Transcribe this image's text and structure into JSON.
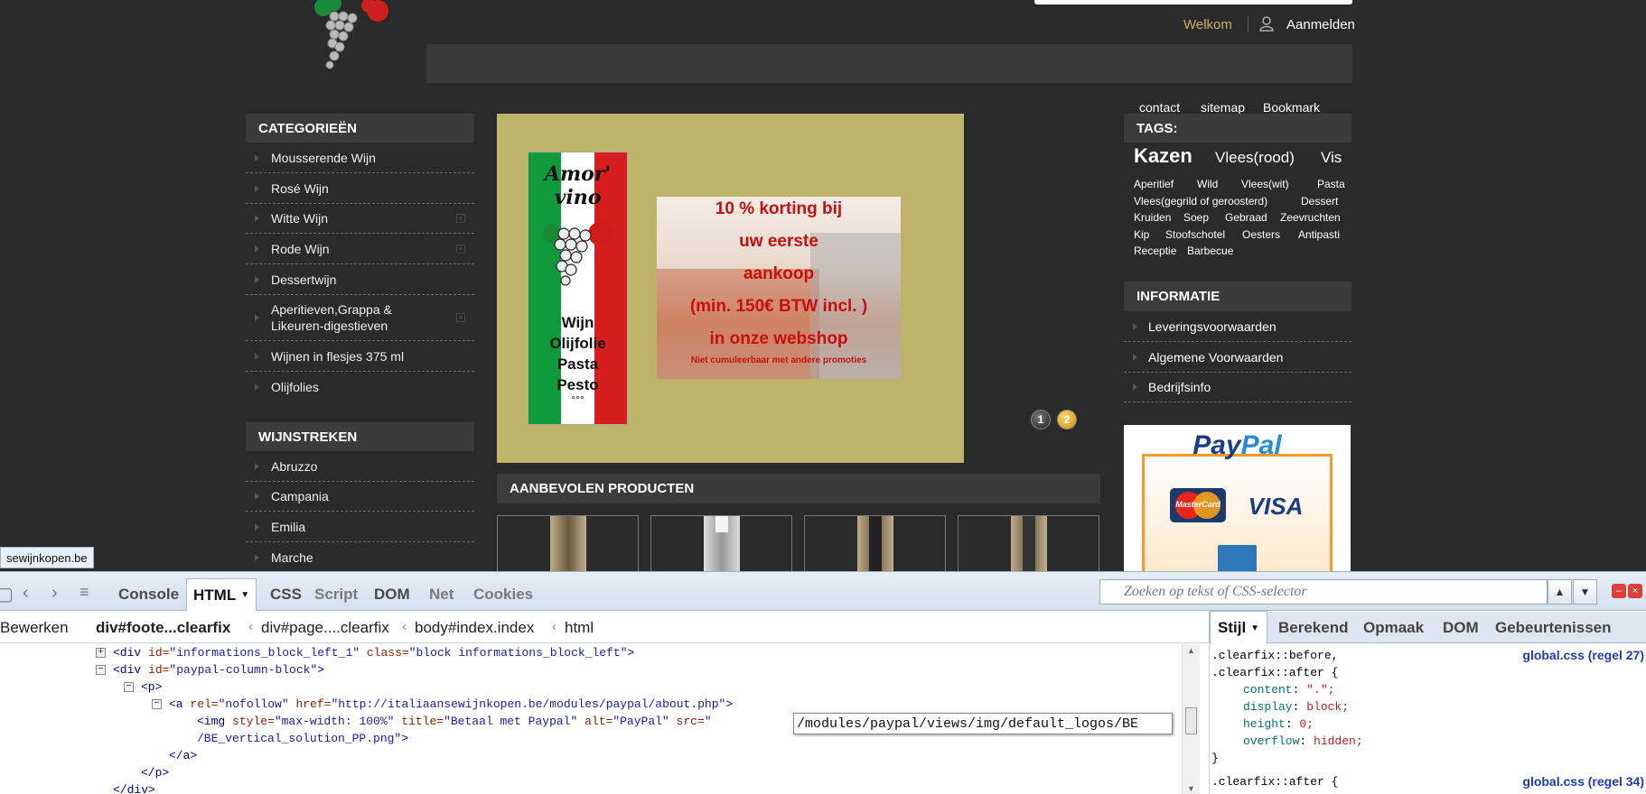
{
  "site": {
    "header": {
      "welcome": "Welkom",
      "login": "Aanmelden"
    },
    "categories": {
      "title": "CATEGORIEËN",
      "items": [
        {
          "label": "Mousserende Wijn",
          "expandable": false
        },
        {
          "label": "Rosé Wijn",
          "expandable": false
        },
        {
          "label": "Witte Wijn",
          "expandable": true
        },
        {
          "label": "Rode Wijn",
          "expandable": true
        },
        {
          "label": "Dessertwijn",
          "expandable": false
        },
        {
          "label": "Aperitieven,Grappa & Likeuren-digestieven",
          "expandable": true
        },
        {
          "label": "Wijnen in flesjes 375 ml",
          "expandable": false
        },
        {
          "label": "Olijfolies",
          "expandable": false
        }
      ]
    },
    "regions": {
      "title": "WIJNSTREKEN",
      "items": [
        "Abruzzo",
        "Campania",
        "Emilia",
        "Marche"
      ]
    },
    "banner": {
      "vertical_title": "Amor' vino",
      "vertical_words": [
        "Wijn",
        "Olijfolie",
        "Pasta",
        "Pesto"
      ],
      "vertical_dots": "°°°",
      "promo_lines": [
        "10 % korting bij",
        "uw eerste",
        "aankoop",
        "(min. 150€ BTW incl. )",
        "in onze webshop"
      ],
      "promo_small": "Niet cumuleerbaar met andere promoties",
      "pages": [
        "1",
        "2"
      ],
      "active_page": 2
    },
    "recommended": {
      "title": "AANBEVOLEN PRODUCTEN"
    },
    "footer_links": [
      "contact",
      "sitemap",
      "Bookmark"
    ],
    "tags": {
      "title": "TAGS:",
      "items": [
        "Kazen",
        "Vlees(rood)",
        "Vis",
        "Aperitief",
        "Wild",
        "Vlees(wit)",
        "Pasta",
        "Vlees(gegrild of geroosterd)",
        "Dessert",
        "Kruiden",
        "Soep",
        "Gebraad",
        "Zeevruchten",
        "Kip",
        "Stoofschotel",
        "Oesters",
        "Antipasti",
        "Receptie",
        "Barbecue"
      ]
    },
    "info": {
      "title": "INFORMATIE",
      "items": [
        "Leveringsvoorwaarden",
        "Algemene Voorwaarden",
        "Bedrijfsinfo"
      ]
    },
    "paypal": {
      "logo_a": "Pay",
      "logo_b": "Pal",
      "mastercard": "MasterCard",
      "visa": "VISA"
    },
    "status_tip": "sewijnkopen.be"
  },
  "firebug": {
    "tabs": [
      "Console",
      "HTML",
      "CSS",
      "Script",
      "DOM",
      "Net",
      "Cookies"
    ],
    "active_tab": "HTML",
    "search_placeholder": "Zoeken op tekst of CSS-selector",
    "edit_label": "Bewerken",
    "breadcrumbs": [
      "div#foote...clearfix",
      "div#page....clearfix",
      "body#index.index",
      "html"
    ],
    "side_tabs": [
      "Stijl",
      "Berekend",
      "Opmaak",
      "DOM",
      "Gebeurtenissen"
    ],
    "html_lines": [
      {
        "tag_open": "<div ",
        "a1": "id=",
        "v1": "\"informations_block_left_1\"",
        "a2": " class=",
        "v2": "\"block informations_block_left\"",
        "tag_close": ">"
      },
      {
        "tag_open": "<div ",
        "a1": "id=",
        "v1": "\"paypal-column-block\"",
        "tag_close": ">"
      },
      {
        "tag_open": "<p>"
      },
      {
        "tag_open": "<a ",
        "a1": "rel=",
        "v1": "\"nofollow\"",
        "a2": " href=",
        "v2": "\"http://italiaansewijnkopen.be/modules/paypal/about.php\"",
        "tag_close": ">"
      },
      {
        "tag_open": "<img ",
        "a1": "style=",
        "v1": "\"max-width: 100%\"",
        "a2": " title=",
        "v2": "\"Betaal met Paypal\"",
        "a3": " alt=",
        "v3": "\"PayPal\"",
        "a4": " src=",
        "v4": "\""
      },
      {
        "cont": "/BE_vertical_solution_PP.png\"",
        "tag_close": ">"
      },
      {
        "tag_open": "</a>"
      },
      {
        "tag_open": "</p>"
      },
      {
        "tag_open": "</div>"
      }
    ],
    "tooltip": "/modules/paypal/views/img/default_logos/BE",
    "css_rules": [
      {
        "text": ".clearfix::before,",
        "source": "global.css (regel 27)"
      },
      {
        "text": ".clearfix::after {"
      },
      {
        "prop": "content",
        "val": "\".\";"
      },
      {
        "prop": "display",
        "val": "block;"
      },
      {
        "prop": "height",
        "val": "0;"
      },
      {
        "prop": "overflow",
        "val": "hidden;"
      },
      {
        "text": "}"
      },
      {
        "text": ".clearfix::after {",
        "source": "global.css (regel 34)"
      }
    ]
  }
}
